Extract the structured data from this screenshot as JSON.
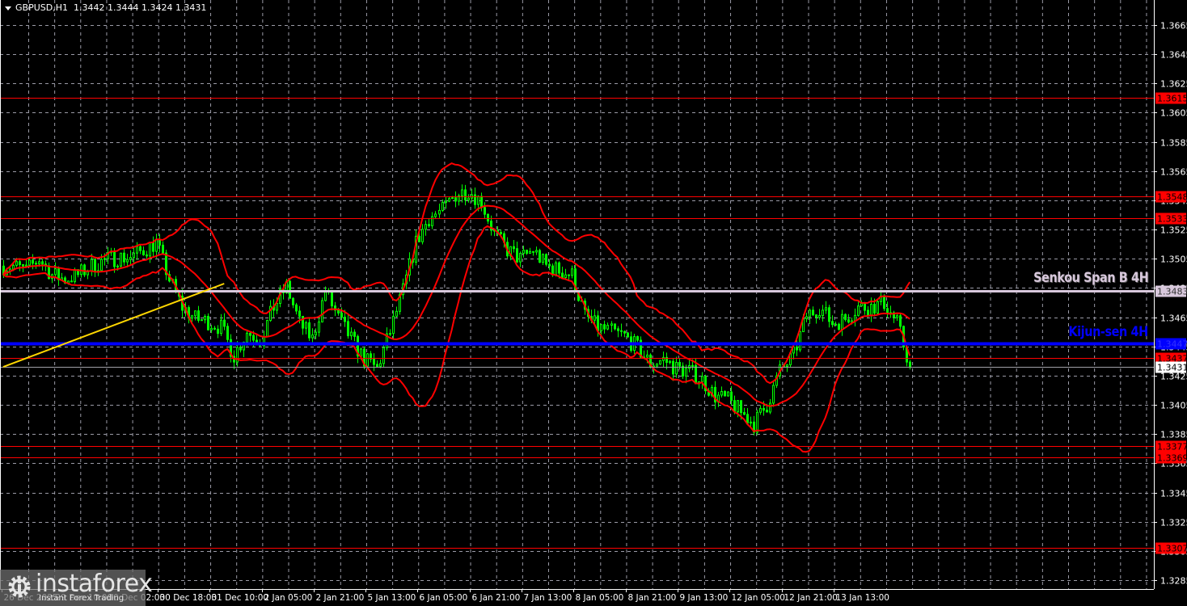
{
  "header": {
    "symbol": "GBPUSD,H1",
    "ohlc": "1.3442 1.3444 1.3424 1.3431"
  },
  "logo": {
    "name": "instaforex",
    "tagline": "Instant Forex Trading"
  },
  "colors": {
    "background": "#000000",
    "candle": "#00ff00",
    "bands": "#ff0000",
    "grid": "#9a9aa6",
    "trendline": "#ffd700",
    "senkou": "#d8c8dc",
    "kijun": "#0000ff",
    "level": "#ff0000",
    "current": "#a0a0a8"
  },
  "annotations": {
    "senkou_label": "Senkou Span B 4H",
    "kijun_label": "Kijun-sen 4H"
  },
  "chart_data": {
    "type": "candlestick",
    "title": "GBPUSD,H1",
    "ylim": [
      1.3275,
      1.3685
    ],
    "y_ticks": [
      "1.3665",
      "1.3645",
      "1.3625",
      "1.3605",
      "1.3585",
      "1.3565",
      "1.3545",
      "1.3525",
      "1.3505",
      "1.3485",
      "1.3465",
      "1.3445",
      "1.3425",
      "1.3405",
      "1.3385",
      "1.3365",
      "1.3345",
      "1.3325",
      "1.3305",
      "1.3285"
    ],
    "x_ticks": [
      "26 Dec 2025",
      "29 Dec 10:00",
      "30 Dec 02:00",
      "30 Dec 18:00",
      "31 Dec 10:00",
      "2 Jan 05:00",
      "2 Jan 21:00",
      "5 Jan 13:00",
      "6 Jan 05:00",
      "6 Jan 21:00",
      "7 Jan 13:00",
      "8 Jan 05:00",
      "8 Jan 21:00",
      "9 Jan 13:00",
      "12 Jan 05:00",
      "12 Jan 21:00",
      "13 Jan 13:00"
    ],
    "bars_per_tick": 16,
    "closes_4h": [
      1.35,
      1.3497,
      1.3505,
      1.3494,
      1.3491,
      1.3494,
      1.35,
      1.3504,
      1.3506,
      1.3506,
      1.3511,
      1.3516,
      1.3491,
      1.3472,
      1.3464,
      1.3462,
      1.3458,
      1.3439,
      1.3455,
      1.345,
      1.3472,
      1.3486,
      1.3461,
      1.345,
      1.3483,
      1.3464,
      1.345,
      1.3436,
      1.343,
      1.3455,
      1.3483,
      1.3516,
      1.3533,
      1.3538,
      1.3549,
      1.3552,
      1.3544,
      1.3522,
      1.3511,
      1.3505,
      1.3511,
      1.35,
      1.3497,
      1.3494,
      1.3466,
      1.3458,
      1.3455,
      1.3452,
      1.3444,
      1.3433,
      1.3436,
      1.343,
      1.3428,
      1.3422,
      1.3411,
      1.3408,
      1.34,
      1.3392,
      1.3405,
      1.3428,
      1.3439,
      1.3466,
      1.3472,
      1.3461,
      1.3464,
      1.3472,
      1.3472,
      1.3475,
      1.3461,
      1.3431
    ],
    "levels": [
      {
        "price": 1.3615,
        "label": "1.3615",
        "kind": "level"
      },
      {
        "price": 1.3548,
        "label": "1.3548",
        "kind": "level"
      },
      {
        "price": 1.3533,
        "label": "1.3533",
        "kind": "level"
      },
      {
        "price": 1.3483,
        "label": "1.3483",
        "kind": "senkou"
      },
      {
        "price": 1.3447,
        "label": "1.3447",
        "kind": "kijun"
      },
      {
        "price": 1.3437,
        "label": "1.3437",
        "kind": "level"
      },
      {
        "price": 1.3431,
        "label": "1.3431",
        "kind": "current"
      },
      {
        "price": 1.3377,
        "label": "1.3377",
        "kind": "level"
      },
      {
        "price": 1.3369,
        "label": "1.3369",
        "kind": "level"
      },
      {
        "price": 1.3307,
        "label": "1.3307",
        "kind": "level"
      }
    ],
    "trendline": {
      "from_bar": 0,
      "from_price": 1.3431,
      "to_bar": 68,
      "to_price": 1.3488
    },
    "bollinger": {
      "period": 20,
      "deviation": 2
    }
  }
}
